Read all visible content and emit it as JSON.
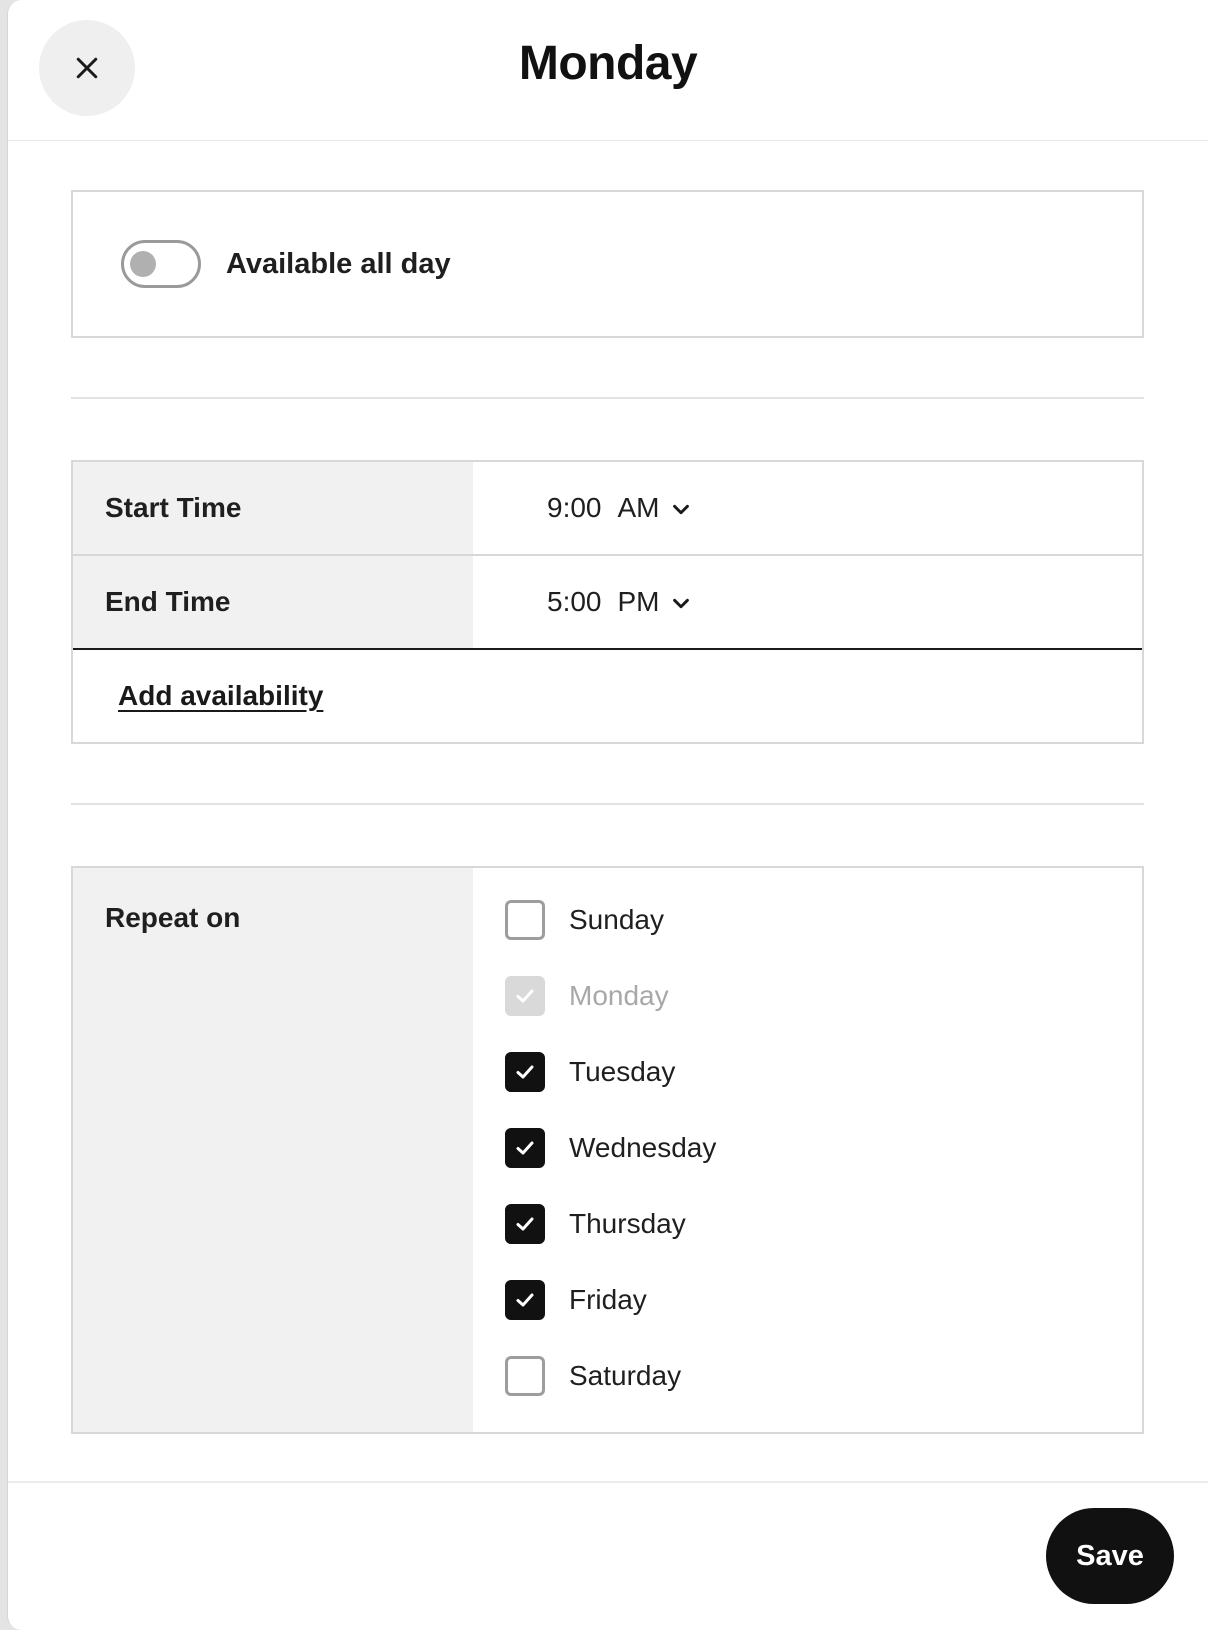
{
  "header": {
    "title": "Monday",
    "close_icon": "close-icon"
  },
  "all_day": {
    "label": "Available all day",
    "enabled": false
  },
  "times": {
    "start": {
      "label": "Start Time",
      "time": "9:00",
      "ampm": "AM"
    },
    "end": {
      "label": "End Time",
      "time": "5:00",
      "ampm": "PM"
    },
    "add_link": "Add availability"
  },
  "repeat": {
    "label": "Repeat on",
    "days": [
      {
        "label": "Sunday",
        "checked": false,
        "disabled": false
      },
      {
        "label": "Monday",
        "checked": true,
        "disabled": true
      },
      {
        "label": "Tuesday",
        "checked": true,
        "disabled": false
      },
      {
        "label": "Wednesday",
        "checked": true,
        "disabled": false
      },
      {
        "label": "Thursday",
        "checked": true,
        "disabled": false
      },
      {
        "label": "Friday",
        "checked": true,
        "disabled": false
      },
      {
        "label": "Saturday",
        "checked": false,
        "disabled": false
      }
    ]
  },
  "footer": {
    "save_label": "Save"
  },
  "colors": {
    "primary": "#111111",
    "panel_gray": "#f1f1f1",
    "border": "#d8d8d8",
    "disabled": "#d9d9d9"
  }
}
